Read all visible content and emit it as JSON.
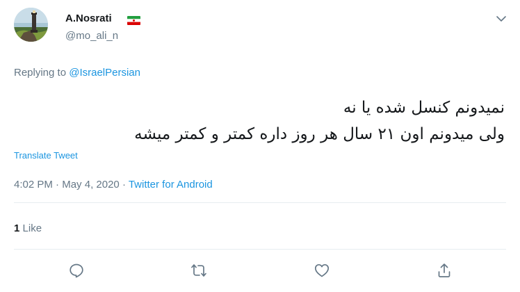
{
  "author": {
    "display_name": "A.Nosrati",
    "handle": "@mo_ali_n",
    "flag_icon": "iran-flag-icon"
  },
  "reply": {
    "prefix": "Replying to ",
    "mention": "@IsraelPersian"
  },
  "tweet": {
    "lines": [
      "نمیدونم کنسل شده یا نه",
      "ولی میدونم اون ۲۱ سال هر روز داره کمتر و کمتر میشه"
    ],
    "translate_label": "Translate Tweet"
  },
  "meta": {
    "time": "4:02 PM",
    "separator": " · ",
    "date": "May 4, 2020",
    "source": "Twitter for Android"
  },
  "stats": {
    "like_count": "1",
    "like_label": "Like"
  },
  "actions": [
    "reply-icon",
    "retweet-icon",
    "like-icon",
    "share-icon"
  ],
  "colors": {
    "link": "#1b95e0",
    "secondary_text": "#657786",
    "primary_text": "#14171a",
    "divider": "#e6ecf0"
  }
}
